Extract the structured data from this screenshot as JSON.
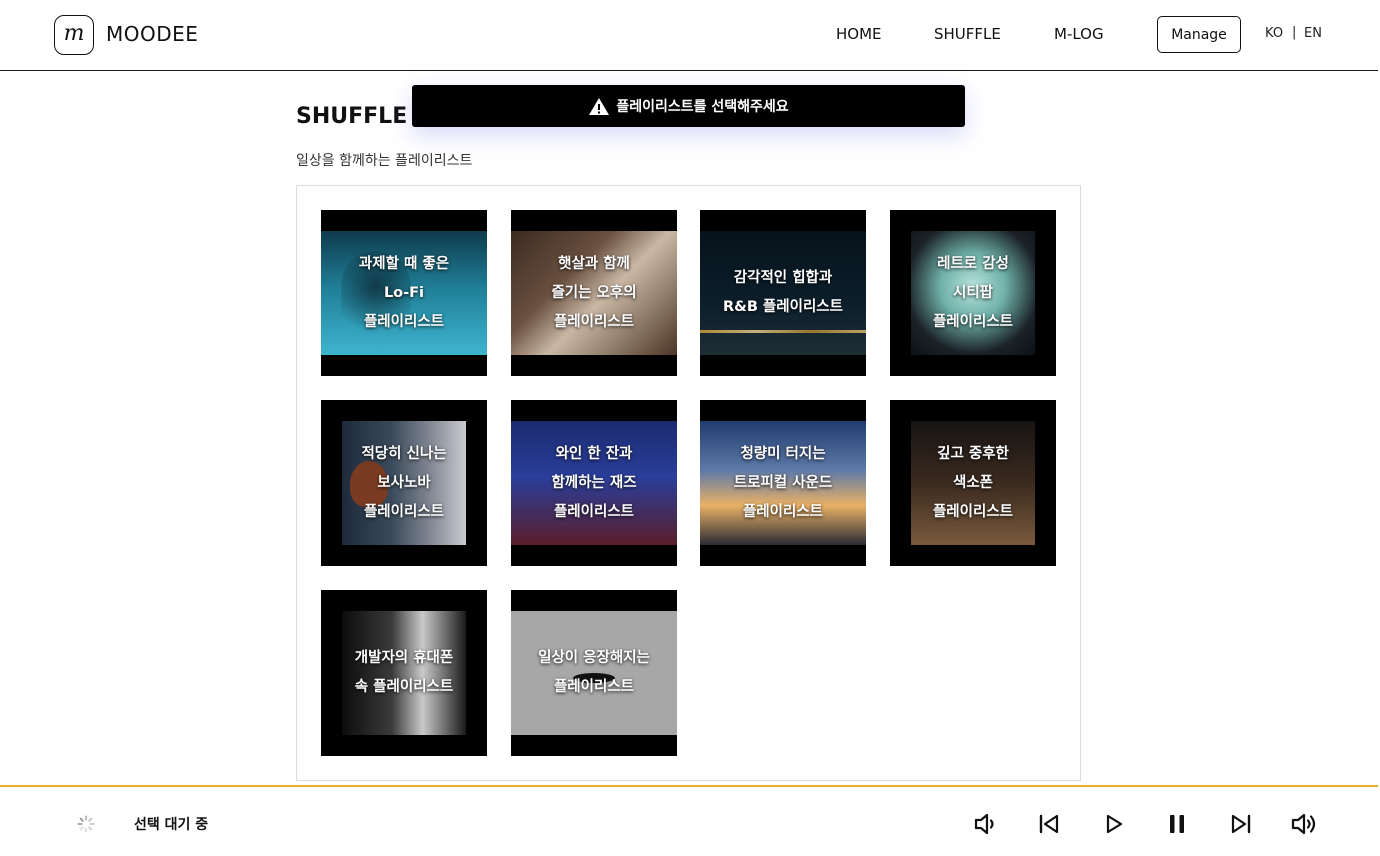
{
  "header": {
    "logo_letter": "m",
    "brand": "MOODEE",
    "nav": [
      "HOME",
      "SHUFFLE",
      "M-LOG"
    ],
    "manage_label": "Manage",
    "lang_ko": "KO",
    "lang_separator": "|",
    "lang_en": "EN"
  },
  "toast": {
    "icon": "warning-icon",
    "message": "플레이리스트를 선택해주세요"
  },
  "page": {
    "title": "SHUFFLE",
    "subtitle": "일상을 함께하는 플레이리스트"
  },
  "playlists": [
    {
      "lines": [
        "과제할 때 좋은",
        "Lo-Fi",
        "플레이리스트"
      ]
    },
    {
      "lines": [
        "햇살과 함께",
        "즐기는 오후의",
        "플레이리스트"
      ]
    },
    {
      "lines": [
        "감각적인 힙합과",
        "R&B 플레이리스트"
      ]
    },
    {
      "lines": [
        "레트로 감성",
        "시티팝",
        "플레이리스트"
      ]
    },
    {
      "lines": [
        "적당히 신나는",
        "보사노바",
        "플레이리스트"
      ]
    },
    {
      "lines": [
        "와인 한 잔과",
        "함께하는 재즈",
        "플레이리스트"
      ]
    },
    {
      "lines": [
        "청량미 터지는",
        "트로피컬 사운드",
        "플레이리스트"
      ]
    },
    {
      "lines": [
        "깊고 중후한",
        "색소폰",
        "플레이리스트"
      ]
    },
    {
      "lines": [
        "개발자의 휴대폰",
        "속 플레이리스트"
      ]
    },
    {
      "lines": [
        "일상이 응장해지는",
        "플레이리스트"
      ]
    }
  ],
  "player": {
    "status": "선택 대기 중",
    "controls": [
      "volume-down-icon",
      "previous-icon",
      "play-icon",
      "pause-icon",
      "next-icon",
      "volume-up-icon"
    ]
  }
}
